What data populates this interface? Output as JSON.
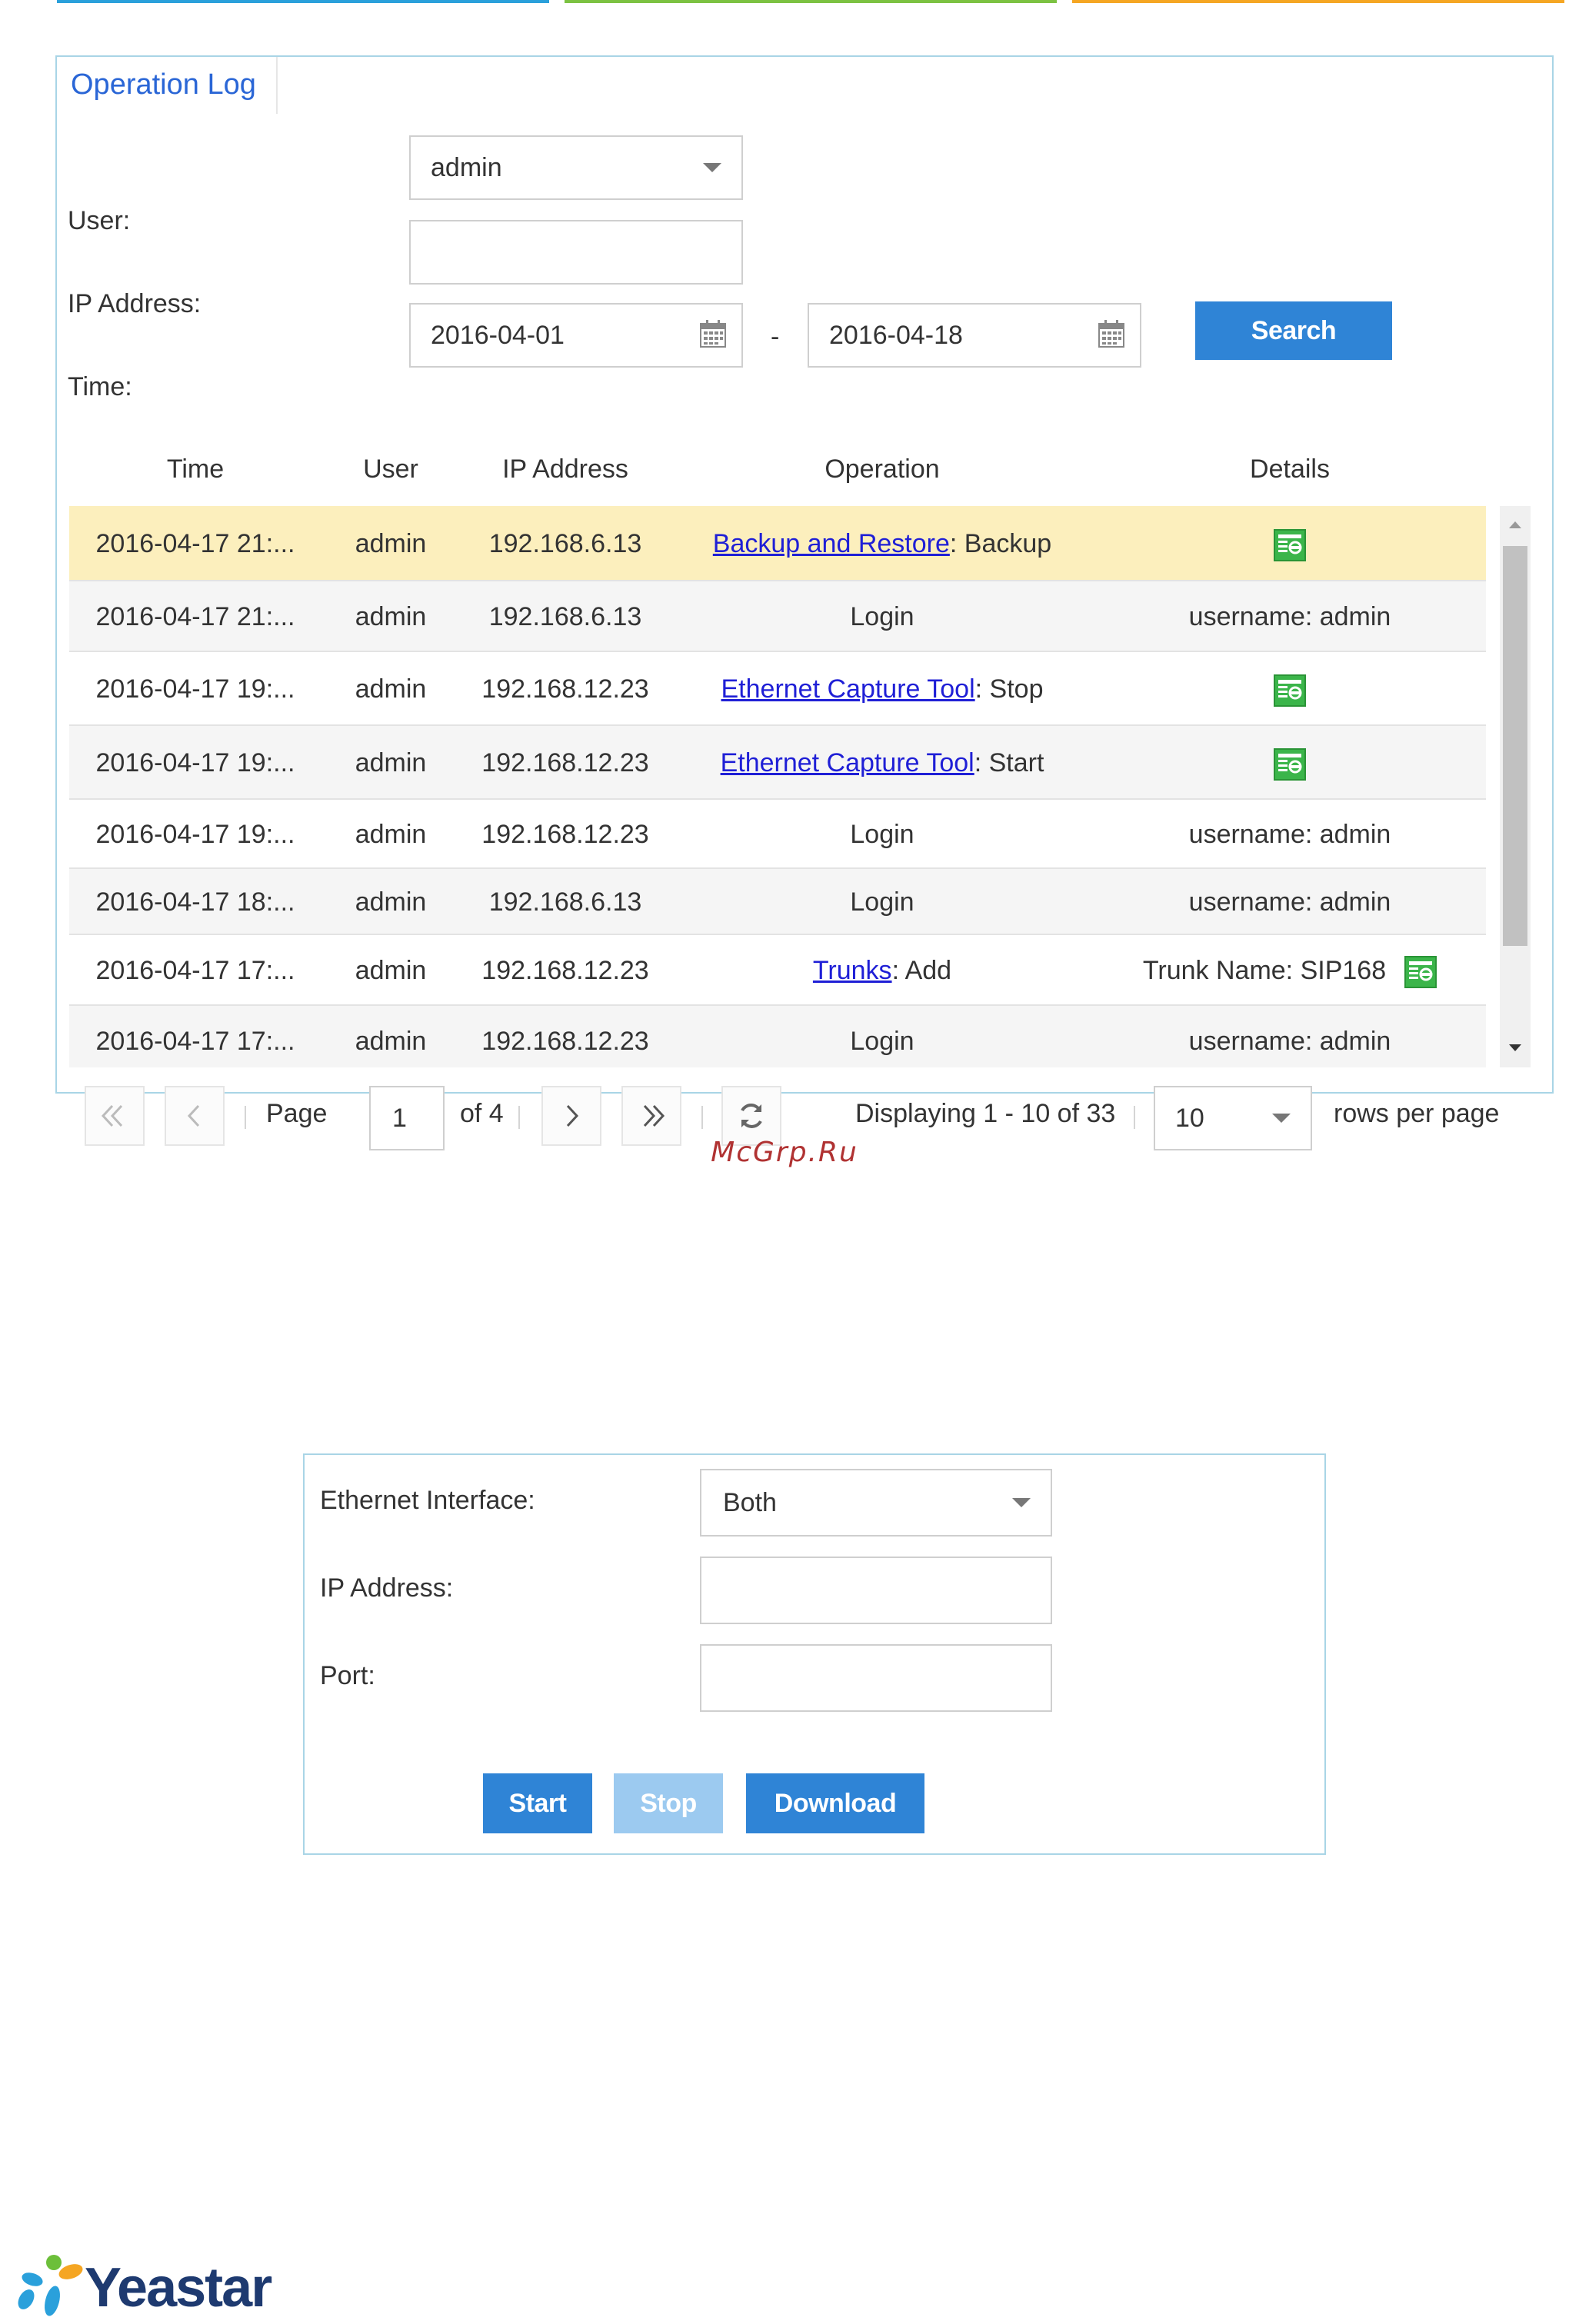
{
  "colors": {
    "accent": "#2f84d6",
    "accent_disabled": "#9ccaf0",
    "link": "#1f1fd6",
    "highlight_row": "#fcefbd",
    "brand": "#1e3a70",
    "watermark": "#b03232"
  },
  "operation_log": {
    "tab_label": "Operation Log",
    "user_label": "User:",
    "user_value": "admin",
    "ip_label": "IP Address:",
    "ip_value": "",
    "time_label": "Time:",
    "time_from": "2016-04-01",
    "time_sep": "-",
    "time_to": "2016-04-18",
    "search_label": "Search",
    "columns": [
      "Time",
      "User",
      "IP Address",
      "Operation",
      "Details"
    ],
    "rows": [
      {
        "time": "2016-04-17 21:...",
        "user": "admin",
        "ip": "192.168.6.13",
        "op_link": "Backup and Restore",
        "op_rest": ": Backup",
        "details": "",
        "icon": "details-icon",
        "highlighted": true
      },
      {
        "time": "2016-04-17 21:...",
        "user": "admin",
        "ip": "192.168.6.13",
        "op_link": "",
        "op_rest": "Login",
        "details": "username: admin",
        "icon": "",
        "highlighted": false
      },
      {
        "time": "2016-04-17 19:...",
        "user": "admin",
        "ip": "192.168.12.23",
        "op_link": "Ethernet Capture Tool",
        "op_rest": ": Stop",
        "details": "",
        "icon": "details-icon",
        "highlighted": false
      },
      {
        "time": "2016-04-17 19:...",
        "user": "admin",
        "ip": "192.168.12.23",
        "op_link": "Ethernet Capture Tool",
        "op_rest": ": Start",
        "details": "",
        "icon": "details-icon",
        "highlighted": false
      },
      {
        "time": "2016-04-17 19:...",
        "user": "admin",
        "ip": "192.168.12.23",
        "op_link": "",
        "op_rest": "Login",
        "details": "username: admin",
        "icon": "",
        "highlighted": false
      },
      {
        "time": "2016-04-17 18:...",
        "user": "admin",
        "ip": "192.168.6.13",
        "op_link": "",
        "op_rest": "Login",
        "details": "username: admin",
        "icon": "",
        "highlighted": false
      },
      {
        "time": "2016-04-17 17:...",
        "user": "admin",
        "ip": "192.168.12.23",
        "op_link": "Trunks",
        "op_rest": ": Add",
        "details": "Trunk Name: SIP168",
        "icon": "details-icon",
        "highlighted": false
      },
      {
        "time": "2016-04-17 17:...",
        "user": "admin",
        "ip": "192.168.12.23",
        "op_link": "",
        "op_rest": "Login",
        "details": "username: admin",
        "icon": "",
        "highlighted": false
      }
    ],
    "pager": {
      "page_label": "Page",
      "page_value": "1",
      "of_label": "of 4",
      "displaying": "Displaying 1 - 10 of 33",
      "rows_value": "10",
      "rows_label": "rows per page"
    }
  },
  "watermark": "McGrp.Ru",
  "ethernet_capture": {
    "interface_label": "Ethernet Interface:",
    "interface_value": "Both",
    "ip_label": "IP Address:",
    "ip_value": "",
    "port_label": "Port:",
    "port_value": "",
    "start_label": "Start",
    "stop_label": "Stop",
    "download_label": "Download"
  },
  "logo_text": "Yeastar"
}
